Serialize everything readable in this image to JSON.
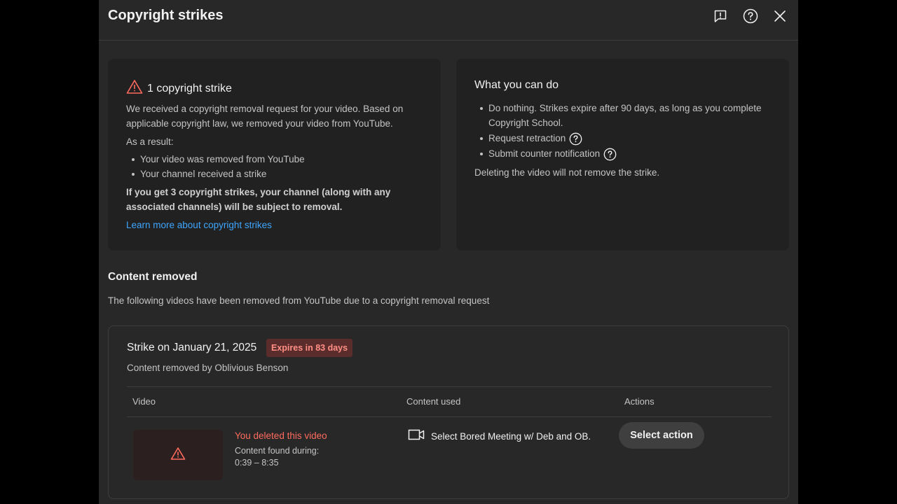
{
  "dialog": {
    "title": "Copyright strikes",
    "header_icons": [
      "feedback-icon",
      "help-icon",
      "close-icon"
    ]
  },
  "strike_summary": {
    "title": "1 copyright strike",
    "description": "We received a copyright removal request for your video. Based on applicable copyright law, we removed your video from YouTube.",
    "result_intro": "As a result:",
    "results": [
      "Your video was removed from YouTube",
      "Your channel received a strike"
    ],
    "warning": "If you get 3 copyright strikes, your channel (along with any associated channels) will be subject to removal.",
    "learn_more": "Learn more about copyright strikes"
  },
  "what_you_can_do": {
    "title": "What you can do",
    "options": [
      "Do nothing. Strikes expire after 90 days, as long as you complete Copyright School.",
      "Request retraction",
      "Submit counter notification"
    ],
    "note": "Deleting the video will not remove the strike."
  },
  "content_removed": {
    "title": "Content removed",
    "subtitle": "The following videos have been removed from YouTube due to a copyright removal request"
  },
  "strike": {
    "date": "Strike on January 21, 2025",
    "expires": "Expires in 83 days",
    "removed_by": "Content removed by Oblivious Benson",
    "columns": [
      "Video",
      "Content used",
      "Actions"
    ],
    "row": {
      "status": "You deleted this video",
      "found_label": "Content found during:",
      "found_range": "0:39 – 8:35",
      "content_used": "Select Bored Meeting w/ Deb and OB.",
      "action_label": "Select action"
    }
  },
  "colors": {
    "background": "#282828",
    "card": "#212121",
    "link": "#3ea6ff",
    "warning": "#ff6b5e",
    "badge_bg": "#5b2c2c"
  }
}
